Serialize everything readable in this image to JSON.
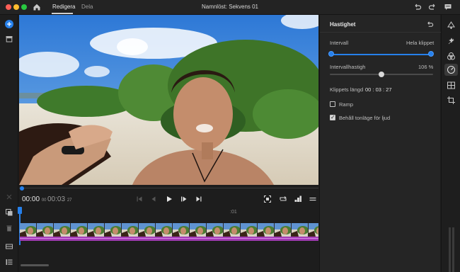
{
  "app": {
    "window_title": "Namnlöst: Sekvens 01",
    "tabs": [
      {
        "label": "Redigera",
        "active": true
      },
      {
        "label": "Dela",
        "active": false
      }
    ]
  },
  "toolbar_icons": [
    "home-icon",
    "undo-icon",
    "redo-icon",
    "feedback-icon"
  ],
  "left_tools": [
    "add-media-button",
    "media-bin-icon",
    "close-icon",
    "duplicate-icon",
    "trash-icon",
    "track-icon",
    "list-icon"
  ],
  "viewer": {
    "timecode_current": "00:00",
    "timecode_current_frames": "00",
    "timecode_total": "00:03",
    "timecode_total_frames": "27",
    "controls": [
      "go-to-start-icon",
      "step-back-icon",
      "play-icon",
      "step-forward-icon",
      "go-to-end-icon",
      "fit-icon",
      "loop-icon",
      "quality-icon",
      "more-icon"
    ]
  },
  "timeline": {
    "ruler_label": ":01"
  },
  "panel": {
    "title": "Hastighet",
    "range_label": "Intervall",
    "range_end_label": "Hela klippet",
    "interval_speed_label": "Intervallhastigh",
    "interval_speed_value": "106 %",
    "clip_length_label": "Klippets längd",
    "clip_length_value": "00 : 03 : 27",
    "ramp_label": "Ramp",
    "ramp_checked": false,
    "keep_pitch_label": "Behåll tonläge för ljud",
    "keep_pitch_checked": true,
    "speed_fraction": 0.5
  },
  "right_tools": [
    "crop-transform-icon",
    "effects-icon",
    "color-icon",
    "speed-icon",
    "layout-icon",
    "crop-icon"
  ],
  "colors": {
    "accent": "#2680eb",
    "audio_track": "#a23bb5",
    "panel_bg": "#252525",
    "app_bg": "#1d1d1d"
  }
}
